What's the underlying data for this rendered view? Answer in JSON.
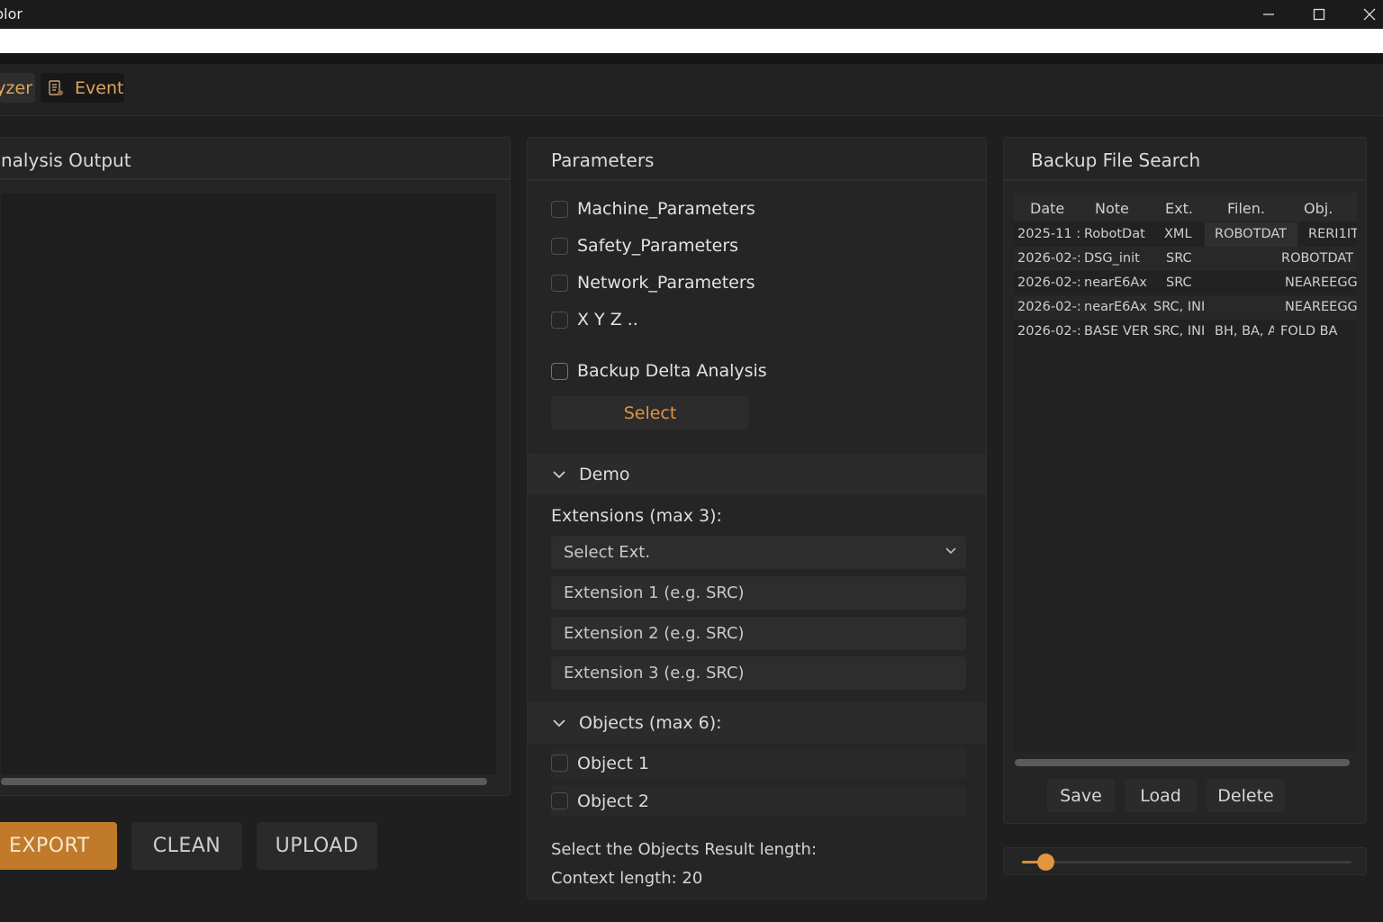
{
  "window": {
    "title": "plor",
    "controls": [
      "minimize-icon",
      "maximize-icon",
      "close-icon"
    ]
  },
  "tabs": [
    {
      "label": "yzer"
    },
    {
      "label": "Event",
      "icon": "document-icon"
    }
  ],
  "analysis": {
    "title": "nalysis Output",
    "buttons": {
      "export": "EXPORT",
      "clean": "CLEAN",
      "upload": "UPLOAD"
    }
  },
  "parameters": {
    "title": "Parameters",
    "checkboxes": [
      {
        "label": "Machine_Parameters",
        "checked": false
      },
      {
        "label": "Safety_Parameters",
        "checked": false
      },
      {
        "label": "Network_Parameters",
        "checked": false
      },
      {
        "label": "X Y Z ..",
        "checked": false
      }
    ],
    "delta": {
      "label": "Backup Delta Analysis",
      "checked": false
    },
    "select_button": "Select",
    "demo": {
      "header": "Demo",
      "extensions_label": "Extensions (max 3):",
      "select_ext": "Select Ext.",
      "ext_placeholders": [
        "Extension 1 (e.g. SRC)",
        "Extension 2 (e.g. SRC)",
        "Extension 3 (e.g. SRC)"
      ]
    },
    "objects": {
      "header": "Objects (max 6):",
      "items": [
        "Object 1",
        "Object 2"
      ],
      "result_label": "Select the Objects Result length:",
      "context_label": "Context length: 20"
    }
  },
  "backup": {
    "title": "Backup File Search",
    "columns": [
      "Date",
      "Note",
      "Ext.",
      "Filen.",
      "Obj."
    ],
    "rows": [
      {
        "date": "2025-11 :",
        "note": "RobotDat",
        "ext": "XML",
        "filen": "ROBOTDAT",
        "obj": "RERI1IT"
      },
      {
        "date": "2026-02-:",
        "note": "DSG_init",
        "ext": "SRC",
        "filen": "",
        "obj": "ROBOTDAT"
      },
      {
        "date": "2026-02-:",
        "note": "nearE6Ax",
        "ext": "SRC",
        "filen": "",
        "obj": "NEAREEGG"
      },
      {
        "date": "2026-02-:",
        "note": "nearE6Ax",
        "ext": "SRC, INI",
        "filen": "",
        "obj": "NEAREEGG"
      },
      {
        "date": "2026-02-:",
        "note": "BASE VER",
        "ext": "SRC, INI",
        "filen": "BH, BA, A",
        "obj": "FOLD BA"
      }
    ],
    "buttons": {
      "save": "Save",
      "load": "Load",
      "delete": "Delete"
    }
  },
  "context_slider": {
    "value_fraction": 0.07
  },
  "colors": {
    "accent": "#d88e38",
    "background": "#1f1f1f",
    "panel": "#252525"
  }
}
